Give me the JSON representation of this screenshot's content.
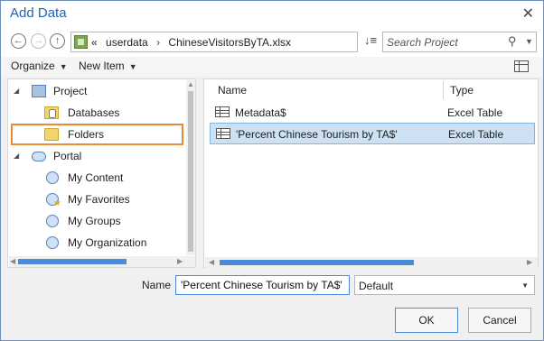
{
  "window": {
    "title": "Add Data",
    "close_glyph": "✕"
  },
  "navbar": {
    "back_glyph": "←",
    "forward_glyph": "→",
    "up_glyph": "↑",
    "crumb_prefix": "«",
    "crumbs": [
      "userdata",
      "›",
      "ChineseVisitorsByTA.xlsx"
    ],
    "refresh_glyph": "↻",
    "sort_glyph": "↓≡",
    "search_placeholder": "Search Project"
  },
  "toolbar": {
    "organize": "Organize",
    "new_item": "New Item"
  },
  "tree": {
    "items": [
      {
        "label": "Project",
        "icon": "project-icon"
      },
      {
        "label": "Databases",
        "icon": "database-icon"
      },
      {
        "label": "Folders",
        "icon": "folder-icon"
      },
      {
        "label": "Portal",
        "icon": "cloud-icon"
      },
      {
        "label": "My Content",
        "icon": "my-content-icon"
      },
      {
        "label": "My Favorites",
        "icon": "favorites-icon"
      },
      {
        "label": "My Groups",
        "icon": "groups-icon"
      },
      {
        "label": "My Organization",
        "icon": "organization-icon"
      }
    ]
  },
  "list": {
    "columns": [
      "Name",
      "Type"
    ],
    "rows": [
      {
        "name": "Metadata$",
        "type": "Excel Table",
        "selected": false
      },
      {
        "name": "'Percent Chinese Tourism by TA$'",
        "type": "Excel Table",
        "selected": true
      }
    ]
  },
  "footer": {
    "name_label": "Name",
    "name_value": "'Percent Chinese Tourism by TA$'",
    "filter_value": "Default",
    "ok": "OK",
    "cancel": "Cancel"
  },
  "colors": {
    "accent": "#1f64b4",
    "selection": "#cde1f3",
    "highlight_border": "#e88b34"
  }
}
